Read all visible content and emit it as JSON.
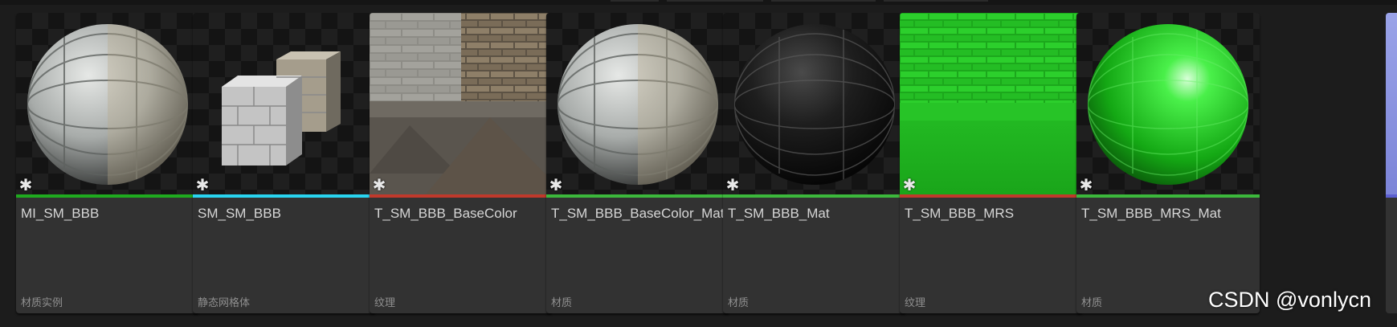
{
  "colors": {
    "material_instance": "#1faa1f",
    "static_mesh": "#29d4f0",
    "texture": "#c0392b",
    "material": "#3cb83c"
  },
  "assets": [
    {
      "name": "MI_SM_BBB",
      "type": "材质实例",
      "badge": "✱",
      "color_key": "material_instance",
      "thumb": "sphere-stone"
    },
    {
      "name": "SM_SM_BBB",
      "type": "静态网格体",
      "badge": "✱",
      "color_key": "static_mesh",
      "thumb": "cubes-stone"
    },
    {
      "name": "T_SM_BBB_BaseColor",
      "type": "纹理",
      "badge": "✱",
      "color_key": "texture",
      "thumb": "texture-basecolor"
    },
    {
      "name": "T_SM_BBB_BaseColor_Mat",
      "type": "材质",
      "badge": "✱",
      "color_key": "material",
      "thumb": "sphere-stone"
    },
    {
      "name": "T_SM_BBB_Mat",
      "type": "材质",
      "badge": "✱",
      "color_key": "material",
      "thumb": "sphere-black"
    },
    {
      "name": "T_SM_BBB_MRS",
      "type": "纹理",
      "badge": "✱",
      "color_key": "texture",
      "thumb": "texture-green"
    },
    {
      "name": "T_SM_BBB_MRS_Mat",
      "type": "材质",
      "badge": "✱",
      "color_key": "material",
      "thumb": "sphere-green"
    }
  ],
  "watermark": "CSDN @vonlycn"
}
